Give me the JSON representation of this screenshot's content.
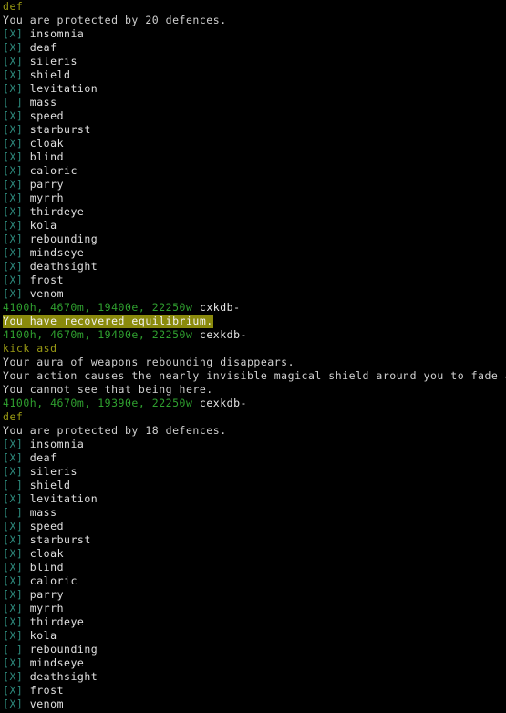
{
  "terminal": {
    "title": "mud-client-terminal",
    "colors": {
      "background": "#000000",
      "command_echo": "#9a9a14",
      "body_text": "#d0d0d0",
      "checkbox": "#2e8b7e",
      "defence_name": "#e0e0e0",
      "vitals_green": "#2fa02f",
      "prompt_flags": "#e8e8e8",
      "highlight_background": "#8a8a0c",
      "highlight_text": "#f2f2f2"
    },
    "lines": [
      {
        "type": "command",
        "text": "def"
      },
      {
        "type": "text",
        "text": "You are protected by 20 defences."
      },
      {
        "type": "defence",
        "mark": "[X]",
        "name": "insomnia"
      },
      {
        "type": "defence",
        "mark": "[X]",
        "name": "deaf"
      },
      {
        "type": "defence",
        "mark": "[X]",
        "name": "sileris"
      },
      {
        "type": "defence",
        "mark": "[X]",
        "name": "shield"
      },
      {
        "type": "defence",
        "mark": "[X]",
        "name": "levitation"
      },
      {
        "type": "defence",
        "mark": "[ ]",
        "name": "mass"
      },
      {
        "type": "defence",
        "mark": "[X]",
        "name": "speed"
      },
      {
        "type": "defence",
        "mark": "[X]",
        "name": "starburst"
      },
      {
        "type": "defence",
        "mark": "[X]",
        "name": "cloak"
      },
      {
        "type": "defence",
        "mark": "[X]",
        "name": "blind"
      },
      {
        "type": "defence",
        "mark": "[X]",
        "name": "caloric"
      },
      {
        "type": "defence",
        "mark": "[X]",
        "name": "parry"
      },
      {
        "type": "defence",
        "mark": "[X]",
        "name": "myrrh"
      },
      {
        "type": "defence",
        "mark": "[X]",
        "name": "thirdeye"
      },
      {
        "type": "defence",
        "mark": "[X]",
        "name": "kola"
      },
      {
        "type": "defence",
        "mark": "[X]",
        "name": "rebounding"
      },
      {
        "type": "defence",
        "mark": "[X]",
        "name": "mindseye"
      },
      {
        "type": "defence",
        "mark": "[X]",
        "name": "deathsight"
      },
      {
        "type": "defence",
        "mark": "[X]",
        "name": "frost"
      },
      {
        "type": "defence",
        "mark": "[X]",
        "name": "venom"
      },
      {
        "type": "prompt",
        "vitals": "4100h, 4670m, 19400e, 22250w",
        "flags": "cxkdb-"
      },
      {
        "type": "highlight",
        "text": "You have recovered equilibrium."
      },
      {
        "type": "prompt",
        "vitals": "4100h, 4670m, 19400e, 22250w",
        "flags": "cexkdb-"
      },
      {
        "type": "command",
        "text": "kick asd"
      },
      {
        "type": "text",
        "text": "Your aura of weapons rebounding disappears."
      },
      {
        "type": "text",
        "text": "Your action causes the nearly invisible magical shield around you to fade away."
      },
      {
        "type": "text",
        "text": "You cannot see that being here."
      },
      {
        "type": "prompt",
        "vitals": "4100h, 4670m, 19390e, 22250w",
        "flags": "cexkdb-"
      },
      {
        "type": "command",
        "text": "def"
      },
      {
        "type": "text",
        "text": "You are protected by 18 defences."
      },
      {
        "type": "defence",
        "mark": "[X]",
        "name": "insomnia"
      },
      {
        "type": "defence",
        "mark": "[X]",
        "name": "deaf"
      },
      {
        "type": "defence",
        "mark": "[X]",
        "name": "sileris"
      },
      {
        "type": "defence",
        "mark": "[ ]",
        "name": "shield"
      },
      {
        "type": "defence",
        "mark": "[X]",
        "name": "levitation"
      },
      {
        "type": "defence",
        "mark": "[ ]",
        "name": "mass"
      },
      {
        "type": "defence",
        "mark": "[X]",
        "name": "speed"
      },
      {
        "type": "defence",
        "mark": "[X]",
        "name": "starburst"
      },
      {
        "type": "defence",
        "mark": "[X]",
        "name": "cloak"
      },
      {
        "type": "defence",
        "mark": "[X]",
        "name": "blind"
      },
      {
        "type": "defence",
        "mark": "[X]",
        "name": "caloric"
      },
      {
        "type": "defence",
        "mark": "[X]",
        "name": "parry"
      },
      {
        "type": "defence",
        "mark": "[X]",
        "name": "myrrh"
      },
      {
        "type": "defence",
        "mark": "[X]",
        "name": "thirdeye"
      },
      {
        "type": "defence",
        "mark": "[X]",
        "name": "kola"
      },
      {
        "type": "defence",
        "mark": "[ ]",
        "name": "rebounding"
      },
      {
        "type": "defence",
        "mark": "[X]",
        "name": "mindseye"
      },
      {
        "type": "defence",
        "mark": "[X]",
        "name": "deathsight"
      },
      {
        "type": "defence",
        "mark": "[X]",
        "name": "frost"
      },
      {
        "type": "defence",
        "mark": "[X]",
        "name": "venom"
      }
    ]
  }
}
